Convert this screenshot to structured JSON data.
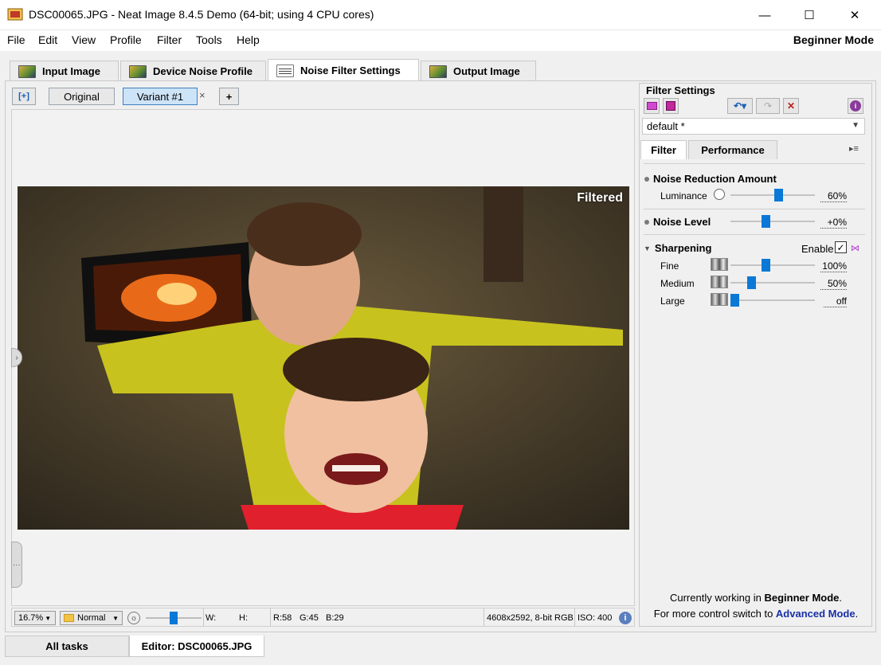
{
  "window": {
    "title": "DSC00065.JPG - Neat Image 8.4.5 Demo (64-bit; using 4 CPU cores)",
    "min_glyph": "—",
    "max_glyph": "☐",
    "close_glyph": "✕"
  },
  "menu": {
    "items": [
      "File",
      "Edit",
      "View",
      "Profile",
      "Filter",
      "Tools",
      "Help"
    ],
    "mode": "Beginner Mode"
  },
  "tabs": [
    {
      "label": "Input Image"
    },
    {
      "label": "Device Noise Profile"
    },
    {
      "label": "Noise Filter Settings"
    },
    {
      "label": "Output Image"
    }
  ],
  "viewer": {
    "fit_glyph": "[+]",
    "original_label": "Original",
    "variant_label": "Variant #1",
    "variant_close": "×",
    "add_glyph": "+",
    "image_overlay": "Filtered"
  },
  "statusbar": {
    "zoom": "16.7%",
    "blend_mode": "Normal",
    "brightness_level": 0.5,
    "w_label": "W:",
    "h_label": "H:",
    "r": "R:58",
    "g": "G:45",
    "b": "B:29",
    "dims": "4608x2592, 8-bit RGB",
    "iso": "ISO: 400"
  },
  "filter_settings": {
    "title": "Filter Settings",
    "preset": "default *",
    "subtabs": [
      "Filter",
      "Performance"
    ],
    "noise_reduction": {
      "heading": "Noise Reduction Amount",
      "luminance_label": "Luminance",
      "luminance_value": "60%",
      "luminance_level": 0.58
    },
    "noise_level": {
      "heading": "Noise Level",
      "value": "+0%",
      "level": 0.41
    },
    "sharpening": {
      "heading": "Sharpening",
      "enable_label": "Enable",
      "enable_checked": "✓",
      "rows": [
        {
          "label": "Fine",
          "value": "100%",
          "level": 0.41
        },
        {
          "label": "Medium",
          "value": "50%",
          "level": 0.22
        },
        {
          "label": "Large",
          "value": "off",
          "level": 0.0
        }
      ]
    },
    "footer_line1_prefix": "Currently working in ",
    "footer_line1_bold": "Beginner Mode",
    "footer_line1_suffix": ".",
    "footer_line2_prefix": "For more control switch to ",
    "footer_line2_link": "Advanced Mode",
    "footer_line2_suffix": "."
  },
  "bottom_tabs": {
    "all_tasks": "All tasks",
    "editor": "Editor: DSC00065.JPG"
  },
  "colors": {
    "accent": "#0a78d7",
    "link": "#1a2fa8"
  }
}
